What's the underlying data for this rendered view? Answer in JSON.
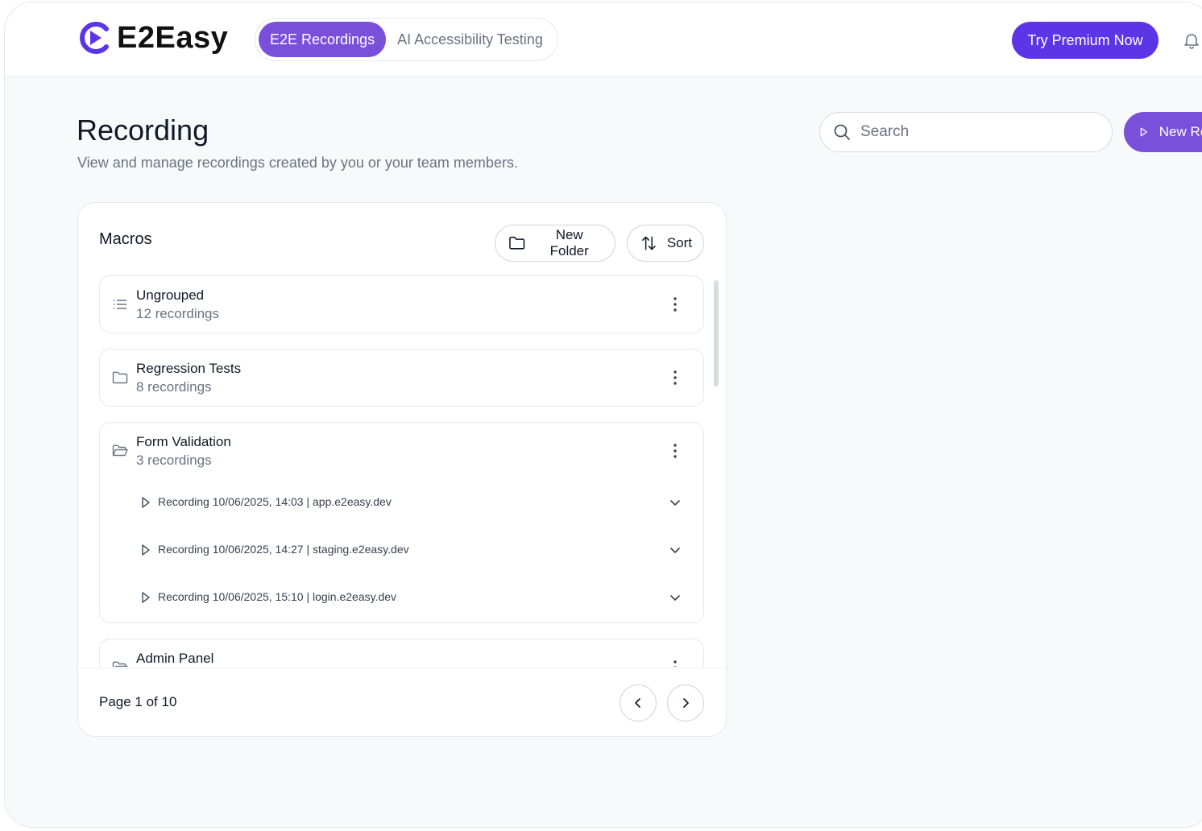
{
  "app": {
    "name": "E2Easy"
  },
  "nav": {
    "tabs": [
      {
        "label": "E2E Recordings",
        "active": true
      },
      {
        "label": "AI Accessibility Testing",
        "active": false
      }
    ]
  },
  "header": {
    "premium_label": "Try Premium Now",
    "bell_icon": "bell-icon"
  },
  "page": {
    "title": "Recording",
    "subtitle": "View and manage recordings created by you or your team members."
  },
  "search": {
    "placeholder": "Search",
    "value": ""
  },
  "actions": {
    "new_recording_label": "New Recording"
  },
  "macros": {
    "title": "Macros",
    "new_folder_label": "New Folder",
    "sort_label": "Sort",
    "groups": [
      {
        "name": "Ungrouped",
        "count": "12 recordings",
        "icon": "list-icon"
      },
      {
        "name": "Regression Tests",
        "count": "8 recordings",
        "icon": "folder-icon"
      },
      {
        "name": "Form Validation",
        "count": "3 recordings",
        "icon": "folder-open-icon",
        "recordings": [
          "Recording 10/06/2025, 14:03 | app.e2easy.dev",
          "Recording 10/06/2025, 14:27 | staging.e2easy.dev",
          "Recording 10/06/2025, 15:10 | login.e2easy.dev"
        ]
      },
      {
        "name": "Admin Panel",
        "count": "",
        "icon": "folder-open-icon"
      }
    ]
  },
  "pagination": {
    "label": "Page 1 of 10"
  },
  "colors": {
    "accent": "#7a4fd9",
    "premium": "#5b35e6",
    "logo": "#5b35e6"
  }
}
